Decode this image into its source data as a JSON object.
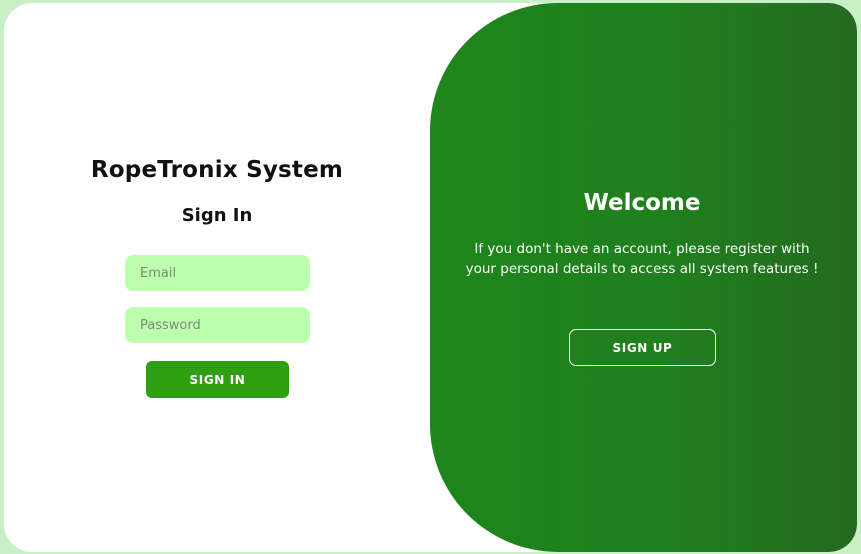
{
  "sign_in": {
    "app_title": "RopeTronix System",
    "heading": "Sign In",
    "email_placeholder": "Email",
    "password_placeholder": "Password",
    "button_label": "SIGN IN",
    "button_color": "#2f9f12",
    "input_color": "#bdffaf"
  },
  "welcome": {
    "heading": "Welcome",
    "message": "If you don't have an account, please register with your personal details to access all system features !",
    "button_label": "SIGN UP",
    "panel_colors": [
      "#1e861c",
      "#246a20"
    ]
  },
  "page": {
    "background_color": "#c8efc5"
  }
}
